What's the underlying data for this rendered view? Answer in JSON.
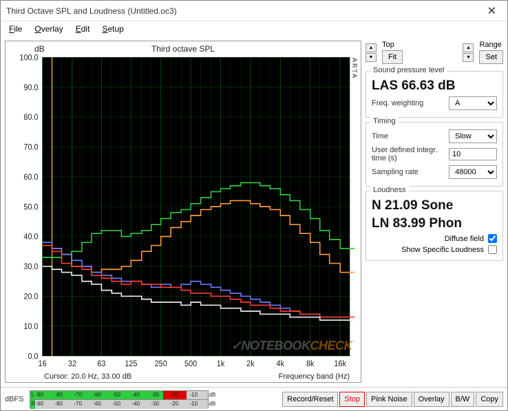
{
  "window": {
    "title": "Third Octave SPL and Loudness (Untitled.oc3)"
  },
  "menu": {
    "file": "File",
    "overlay": "Overlay",
    "edit": "Edit",
    "setup": "Setup"
  },
  "chart_data": {
    "type": "line",
    "title": "Third octave SPL",
    "xlabel": "Frequency band (Hz)",
    "ylabel": "dB",
    "ylim": [
      0,
      100
    ],
    "xlim_log": [
      16,
      20000
    ],
    "x_ticks": [
      16,
      32,
      63,
      125,
      250,
      500,
      1000,
      2000,
      4000,
      8000,
      16000
    ],
    "x_tick_labels": [
      "16",
      "32",
      "63",
      "125",
      "250",
      "500",
      "1k",
      "2k",
      "4k",
      "8k",
      "16k"
    ],
    "y_ticks": [
      0,
      10,
      20,
      30,
      40,
      50,
      60,
      70,
      80,
      90,
      100
    ],
    "x_third_octave": [
      16,
      20,
      25,
      31.5,
      40,
      50,
      63,
      80,
      100,
      125,
      160,
      200,
      250,
      315,
      400,
      500,
      630,
      800,
      1000,
      1250,
      1600,
      2000,
      2500,
      3150,
      4000,
      5000,
      6300,
      8000,
      10000,
      12500,
      16000,
      20000
    ],
    "series": [
      {
        "name": "green",
        "color": "#2ecc40",
        "values": [
          33,
          33,
          34,
          35,
          38,
          41,
          42,
          42,
          40,
          41,
          42,
          44,
          46,
          48,
          49,
          51,
          53,
          55,
          56,
          57,
          58,
          58,
          57,
          56,
          54,
          52,
          49,
          46,
          42,
          39,
          36,
          36
        ]
      },
      {
        "name": "orange",
        "color": "#ff9a3c",
        "values": [
          38,
          36,
          34,
          30,
          30,
          28,
          29,
          29,
          30,
          32,
          35,
          37,
          40,
          43,
          45,
          47,
          49,
          50,
          51,
          52,
          52,
          51,
          50,
          49,
          47,
          44,
          41,
          38,
          34,
          31,
          28,
          28
        ]
      },
      {
        "name": "blue",
        "color": "#6a7bff",
        "values": [
          38,
          36,
          34,
          32,
          30,
          28,
          27,
          26,
          25,
          25,
          24,
          23,
          24,
          23,
          24,
          25,
          24,
          23,
          22,
          21,
          20,
          19,
          18,
          17,
          16,
          15,
          14,
          14,
          13,
          13,
          13,
          13
        ]
      },
      {
        "name": "red",
        "color": "#ff3b30",
        "values": [
          37,
          35,
          31,
          30,
          29,
          27,
          26,
          25,
          24,
          25,
          24,
          24,
          23,
          23,
          22,
          21,
          21,
          20,
          20,
          19,
          18,
          17,
          17,
          16,
          15,
          15,
          14,
          14,
          13,
          13,
          13,
          13
        ]
      },
      {
        "name": "white",
        "color": "#eee",
        "values": [
          30,
          29,
          28,
          27,
          25,
          24,
          22,
          21,
          20,
          20,
          19,
          18,
          18,
          18,
          17,
          18,
          17,
          17,
          16,
          16,
          15,
          15,
          14,
          14,
          14,
          13,
          13,
          13,
          12,
          12,
          12,
          12
        ]
      }
    ],
    "cursor": "Cursor:    20.0 Hz, 33.00 dB"
  },
  "controls": {
    "top_label": "Top",
    "fit_label": "Fit",
    "range_label": "Range",
    "set_label": "Set"
  },
  "spl": {
    "section": "Sound pressure level",
    "readout": "LAS 66.63 dB",
    "weighting_label": "Freq. weighting",
    "weighting_value": "A"
  },
  "timing": {
    "section": "Timing",
    "time_label": "Time",
    "time_value": "Slow",
    "integ_label": "User defined integr. time (s)",
    "integ_value": "10",
    "rate_label": "Sampling rate",
    "rate_value": "48000"
  },
  "loudness": {
    "section": "Loudness",
    "n_readout": "N 21.09 Sone",
    "ln_readout": "LN 83.99 Phon",
    "diffuse_label": "Diffuse field",
    "diffuse_checked": true,
    "specific_label": "Show Specific Loudness",
    "specific_checked": false
  },
  "bottom": {
    "dbfs": "dBFS",
    "meter_ticks": [
      "-90",
      "-80",
      "-70",
      "-60",
      "-50",
      "-40",
      "-30",
      "-20",
      "-10",
      "dB"
    ],
    "left_ch": "L",
    "right_ch": "R",
    "left_level_pct": 88,
    "right_level_pct": 3,
    "record": "Record/Reset",
    "stop": "Stop",
    "pink": "Pink Noise",
    "overlay": "Overlay",
    "bw": "B/W",
    "copy": "Copy"
  },
  "watermark": "NOTEBOOKCHECK",
  "arta": "ARTA"
}
